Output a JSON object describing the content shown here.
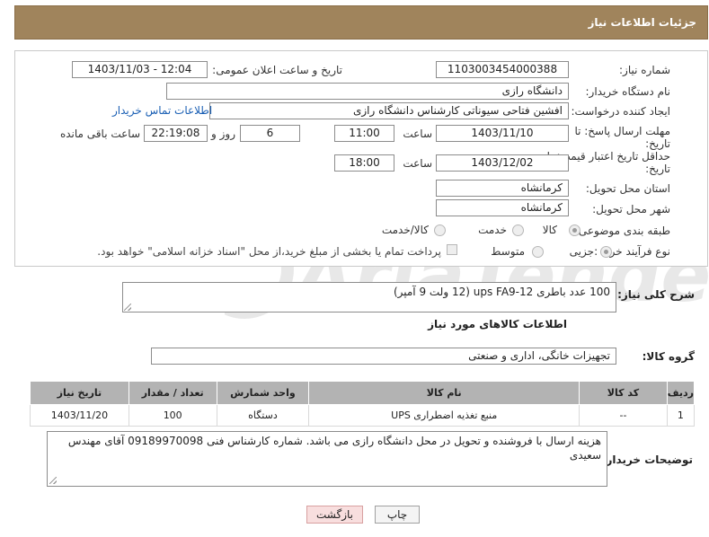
{
  "header": {
    "title": "جزئیات اطلاعات نیاز"
  },
  "form": {
    "need_number": {
      "label": "شماره نیاز:",
      "value": "1103003454000388"
    },
    "announce_datetime": {
      "label": "تاریخ و ساعت اعلان عمومی:",
      "value": "1403/11/03 - 12:04"
    },
    "buyer_org": {
      "label": "نام دستگاه خریدار:",
      "value": "دانشگاه رازی"
    },
    "requester": {
      "label": "ایجاد کننده درخواست:",
      "value": "افشین فتاحی سیوناتی کارشناس دانشگاه رازی",
      "contact_link": "اطلاعات تماس خریدار"
    },
    "reply_deadline": {
      "label_line1": "مهلت ارسال پاسخ: تا",
      "label_line2": "تاریخ:",
      "date": "1403/11/10",
      "time_label": "ساعت",
      "time": "11:00",
      "days": "6",
      "days_label": "روز و",
      "remaining": "22:19:08",
      "remaining_label": "ساعت باقی مانده"
    },
    "price_validity": {
      "label_line1": "حداقل تاریخ اعتبار قیمت: تا",
      "label_line2": "تاریخ:",
      "date": "1403/12/02",
      "time_label": "ساعت",
      "time": "18:00"
    },
    "province": {
      "label": "استان محل تحویل:",
      "value": "کرمانشاه"
    },
    "city": {
      "label": "شهر محل تحویل:",
      "value": "کرمانشاه"
    },
    "category": {
      "label": "طبقه بندی موضوعی:",
      "options": [
        "کالا",
        "خدمت",
        "کالا/خدمت"
      ],
      "selected": "کالا"
    },
    "purchase_type": {
      "label": "نوع فرآیند خرید :",
      "options": [
        "جزیی",
        "متوسط"
      ],
      "selected": "جزیی",
      "note": "پرداخت تمام یا بخشی از مبلغ خرید،از محل \"اسناد خزانه اسلامی\" خواهد بود."
    }
  },
  "description": {
    "label": "شرح کلی نیاز:",
    "value": "100 عدد باطری ups FA9-12 (12 ولت 9 آمپر)"
  },
  "goods_section": {
    "title": "اطلاعات کالاهای مورد نیاز"
  },
  "goods_group": {
    "label": "گروه کالا:",
    "value": "تجهیزات خانگی، اداری و صنعتی"
  },
  "table": {
    "headers": [
      "ردیف",
      "کد کالا",
      "نام کالا",
      "واحد شمارش",
      "تعداد / مقدار",
      "تاریخ نیاز"
    ],
    "rows": [
      [
        "1",
        "--",
        "منبع تغذیه اضطراری UPS",
        "دستگاه",
        "100",
        "1403/11/20"
      ]
    ]
  },
  "buyer_notes": {
    "label": "توضیحات خریدار:",
    "value": "هزینه ارسال با فروشنده و تحویل در محل دانشگاه رازی می باشد. شماره کارشناس فنی 09189970098 آقای مهندس سعیدی"
  },
  "buttons": {
    "print": "چاپ",
    "back": "بازگشت"
  },
  "colors": {
    "header_bg": "#a0845c",
    "table_header_bg": "#b3b3b3",
    "back_button_bg": "#f8dede",
    "link": "#1a5fb4"
  },
  "watermark": {
    "text": "AriaTender.net"
  }
}
